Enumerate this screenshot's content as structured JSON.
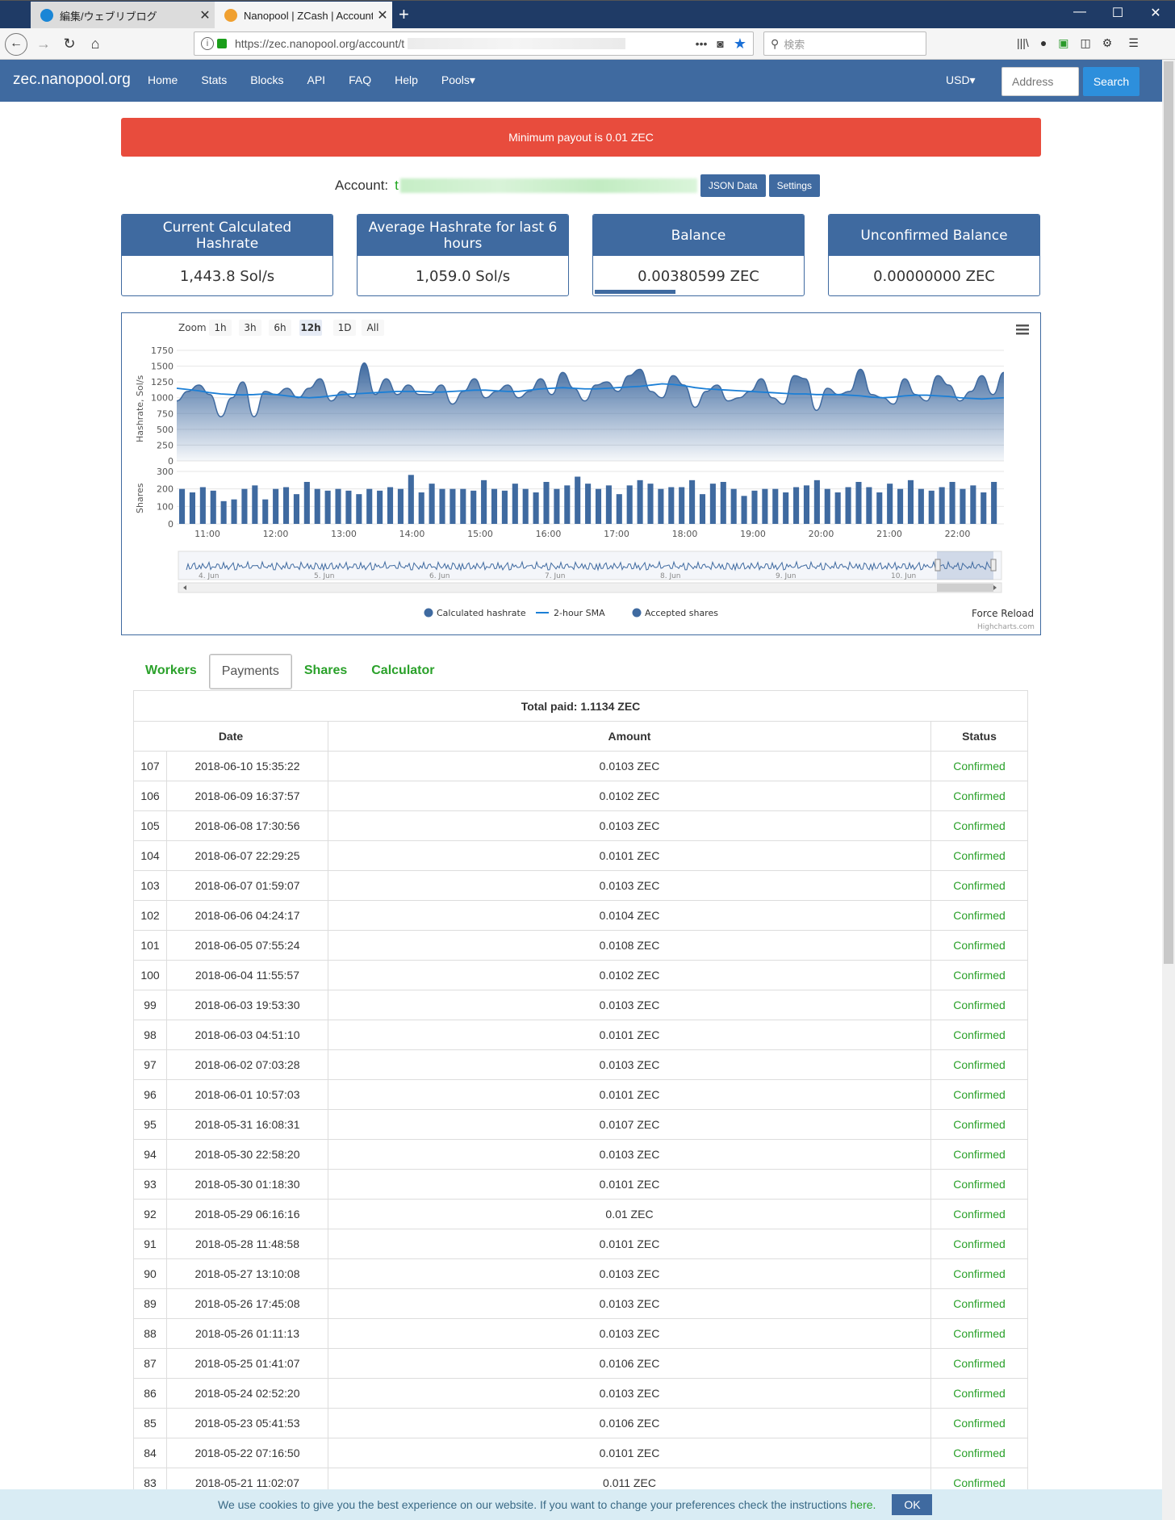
{
  "browser": {
    "tabs": [
      {
        "label": "編集/ウェブリブログ",
        "icon": "bird-icon"
      },
      {
        "label": "Nanopool | ZCash | Account",
        "icon": "nanopool-icon"
      }
    ],
    "url": "https://zec.nanopool.org/account/t",
    "search_placeholder": "検索"
  },
  "site": {
    "brand": "zec.nanopool.org",
    "nav": [
      "Home",
      "Stats",
      "Blocks",
      "API",
      "FAQ",
      "Help",
      "Pools▾"
    ],
    "currency": "USD▾",
    "address_placeholder": "Address",
    "search_label": "Search"
  },
  "alert": "Minimum payout is 0.01 ZEC",
  "account": {
    "label": "Account:",
    "value_prefix": "t",
    "json_button": "JSON Data",
    "settings_button": "Settings"
  },
  "cards": [
    {
      "title": "Current Calculated Hashrate",
      "value": "1,443.8 Sol/s"
    },
    {
      "title": "Average Hashrate for last 6 hours",
      "value": "1,059.0 Sol/s"
    },
    {
      "title": "Balance",
      "value": "0.00380599 ZEC"
    },
    {
      "title": "Unconfirmed Balance",
      "value": "0.00000000 ZEC"
    }
  ],
  "chart_data": {
    "type": "area",
    "zoom_label": "Zoom",
    "zoom_options": [
      "1h",
      "3h",
      "6h",
      "12h",
      "1D",
      "All"
    ],
    "zoom_selected": "12h",
    "hashrate": {
      "ylabel": "Hashrate, Sol/s",
      "yticks": [
        0,
        250,
        500,
        750,
        1000,
        1250,
        1500,
        1750
      ],
      "ylim": [
        0,
        1750
      ],
      "values": [
        950,
        1100,
        1200,
        1050,
        700,
        1000,
        1250,
        700,
        1100,
        1050,
        1150,
        1000,
        1150,
        1300,
        950,
        1100,
        1000,
        1550,
        1050,
        1300,
        1050,
        1200,
        1050,
        1050,
        1200,
        900,
        1100,
        1300,
        1000,
        1100,
        1200,
        1000,
        1100,
        1300,
        1050,
        1400,
        1150,
        950,
        1200,
        1250,
        1100,
        1350,
        1450,
        1100,
        1000,
        1350,
        1200,
        850,
        1100,
        1200,
        950,
        1000,
        1100,
        1300,
        1000,
        900,
        1350,
        1300,
        800,
        1150,
        1050,
        1100,
        1450,
        1050,
        1000,
        900,
        1300,
        1050,
        950,
        1350,
        1200,
        950,
        1100,
        1350,
        1050,
        1400
      ]
    },
    "sma": {
      "values": [
        1150,
        1130,
        1110,
        1080,
        1060,
        1050,
        1045,
        1050,
        1060,
        1050,
        1030,
        1010,
        1000,
        1010,
        1030,
        1050,
        1060,
        1070,
        1080,
        1090,
        1100,
        1100,
        1100,
        1090,
        1090,
        1100,
        1110,
        1120,
        1120,
        1110,
        1100,
        1100,
        1120,
        1140,
        1150,
        1160,
        1150,
        1140,
        1140,
        1150,
        1160,
        1170,
        1180,
        1200,
        1220,
        1210,
        1190,
        1160,
        1140,
        1130,
        1120,
        1110,
        1100,
        1090,
        1080,
        1070,
        1060,
        1060,
        1050,
        1050,
        1050,
        1040,
        1030,
        1010,
        1000,
        1010,
        1030,
        1040,
        1040,
        1030,
        1020,
        1000,
        990,
        980,
        990,
        1000
      ]
    },
    "shares": {
      "ylabel": "Shares",
      "yticks": [
        0,
        100,
        200,
        300
      ],
      "ylim": [
        0,
        300
      ],
      "values": [
        200,
        180,
        210,
        190,
        130,
        140,
        200,
        220,
        140,
        200,
        210,
        170,
        240,
        200,
        190,
        200,
        190,
        170,
        200,
        190,
        210,
        200,
        280,
        180,
        230,
        200,
        200,
        200,
        190,
        250,
        200,
        190,
        230,
        200,
        180,
        240,
        200,
        220,
        270,
        230,
        200,
        220,
        170,
        220,
        250,
        230,
        200,
        210,
        210,
        250,
        170,
        230,
        240,
        200,
        160,
        190,
        200,
        200,
        180,
        210,
        220,
        250,
        200,
        180,
        210,
        240,
        210,
        180,
        230,
        200,
        250,
        200,
        190,
        210,
        240,
        200,
        220,
        180,
        240
      ]
    },
    "x_ticks": [
      "11:00",
      "12:00",
      "13:00",
      "14:00",
      "15:00",
      "16:00",
      "17:00",
      "18:00",
      "19:00",
      "20:00",
      "21:00",
      "22:00"
    ],
    "navigator_labels": [
      "4. Jun",
      "5. Jun",
      "6. Jun",
      "7. Jun",
      "8. Jun",
      "9. Jun",
      "10. Jun"
    ],
    "legend": [
      "Calculated hashrate",
      "2-hour SMA",
      "Accepted shares"
    ],
    "colors": {
      "hashrate": "#3f6aa0",
      "sma": "#1b7fd6",
      "shares": "#3f6aa0"
    },
    "force_reload": "Force Reload",
    "credit": "Highcharts.com"
  },
  "tabs": [
    "Workers",
    "Payments",
    "Shares",
    "Calculator"
  ],
  "tabs_active": "Payments",
  "payments": {
    "total": "Total paid: 1.1134 ZEC",
    "headers": [
      "Date",
      "Amount",
      "Status"
    ],
    "rows": [
      [
        "107",
        "2018-06-10 15:35:22",
        "0.0103 ZEC",
        "Confirmed"
      ],
      [
        "106",
        "2018-06-09 16:37:57",
        "0.0102 ZEC",
        "Confirmed"
      ],
      [
        "105",
        "2018-06-08 17:30:56",
        "0.0103 ZEC",
        "Confirmed"
      ],
      [
        "104",
        "2018-06-07 22:29:25",
        "0.0101 ZEC",
        "Confirmed"
      ],
      [
        "103",
        "2018-06-07 01:59:07",
        "0.0103 ZEC",
        "Confirmed"
      ],
      [
        "102",
        "2018-06-06 04:24:17",
        "0.0104 ZEC",
        "Confirmed"
      ],
      [
        "101",
        "2018-06-05 07:55:24",
        "0.0108 ZEC",
        "Confirmed"
      ],
      [
        "100",
        "2018-06-04 11:55:57",
        "0.0102 ZEC",
        "Confirmed"
      ],
      [
        "99",
        "2018-06-03 19:53:30",
        "0.0103 ZEC",
        "Confirmed"
      ],
      [
        "98",
        "2018-06-03 04:51:10",
        "0.0101 ZEC",
        "Confirmed"
      ],
      [
        "97",
        "2018-06-02 07:03:28",
        "0.0103 ZEC",
        "Confirmed"
      ],
      [
        "96",
        "2018-06-01 10:57:03",
        "0.0101 ZEC",
        "Confirmed"
      ],
      [
        "95",
        "2018-05-31 16:08:31",
        "0.0107 ZEC",
        "Confirmed"
      ],
      [
        "94",
        "2018-05-30 22:58:20",
        "0.0103 ZEC",
        "Confirmed"
      ],
      [
        "93",
        "2018-05-30 01:18:30",
        "0.0101 ZEC",
        "Confirmed"
      ],
      [
        "92",
        "2018-05-29 06:16:16",
        "0.01 ZEC",
        "Confirmed"
      ],
      [
        "91",
        "2018-05-28 11:48:58",
        "0.0101 ZEC",
        "Confirmed"
      ],
      [
        "90",
        "2018-05-27 13:10:08",
        "0.0103 ZEC",
        "Confirmed"
      ],
      [
        "89",
        "2018-05-26 17:45:08",
        "0.0103 ZEC",
        "Confirmed"
      ],
      [
        "88",
        "2018-05-26 01:11:13",
        "0.0103 ZEC",
        "Confirmed"
      ],
      [
        "87",
        "2018-05-25 01:41:07",
        "0.0106 ZEC",
        "Confirmed"
      ],
      [
        "86",
        "2018-05-24 02:52:20",
        "0.0103 ZEC",
        "Confirmed"
      ],
      [
        "85",
        "2018-05-23 05:41:53",
        "0.0106 ZEC",
        "Confirmed"
      ],
      [
        "84",
        "2018-05-22 07:16:50",
        "0.0101 ZEC",
        "Confirmed"
      ],
      [
        "83",
        "2018-05-21 11:02:07",
        "0.011 ZEC",
        "Confirmed"
      ]
    ]
  },
  "cookie": {
    "text": "We use cookies to give you the best experience on our website. If you want to change your preferences check the instructions",
    "link": "here.",
    "ok": "OK"
  }
}
